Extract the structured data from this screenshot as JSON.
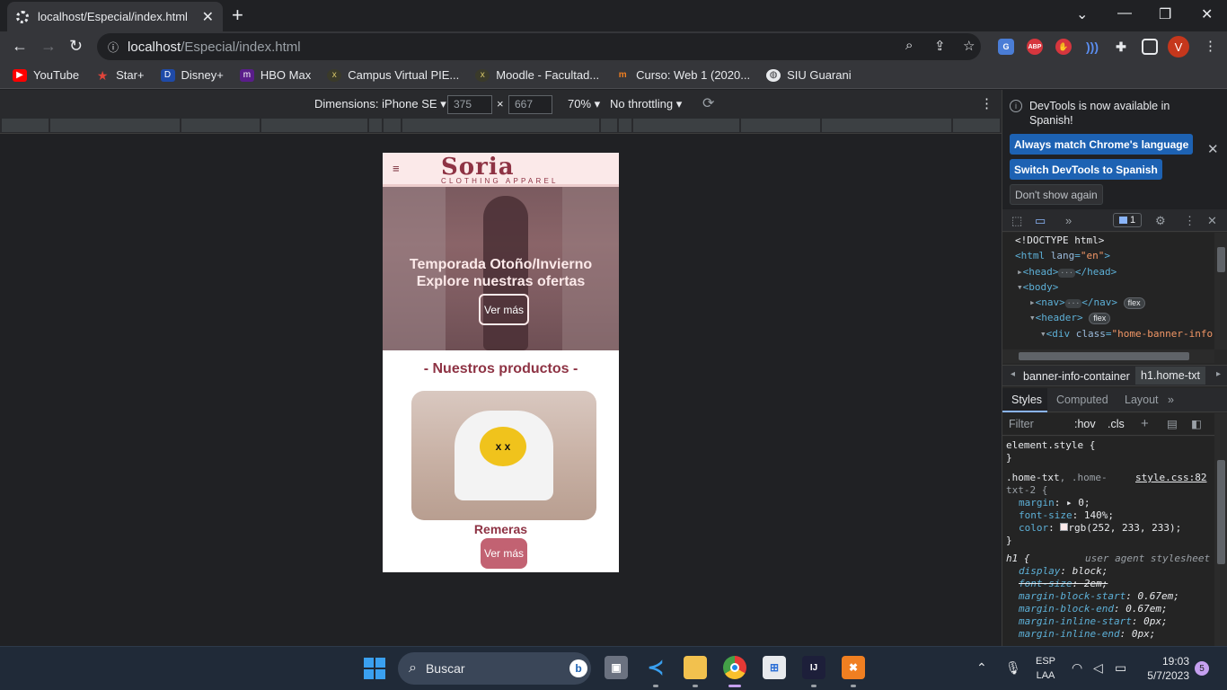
{
  "tab": {
    "title": "localhost/Especial/index.html",
    "close": "✕",
    "new_tab": "+"
  },
  "window": {
    "minimize": "—",
    "maximize": "❐",
    "close": "✕",
    "tab_search": "⌄"
  },
  "address": {
    "host": "localhost",
    "path": "/Especial/index.html"
  },
  "profile": {
    "initial": "V",
    "color": "#c5371c"
  },
  "extensions": [
    {
      "name": "translate-icon",
      "label": "G",
      "color": "#4a7dd6"
    },
    {
      "name": "adblock-icon",
      "label": "ABP",
      "color": "#d6363e"
    },
    {
      "name": "stop-hand-icon",
      "label": "✋",
      "color": "#d6363e"
    },
    {
      "name": "waves-icon",
      "label": ")",
      "color": "#3b6fd6"
    }
  ],
  "bookmarks": [
    {
      "label": "YouTube",
      "icon": "youtube-icon",
      "glyph": "▶",
      "color": "#ff0000"
    },
    {
      "label": "Star+",
      "icon": "star-icon",
      "glyph": "★",
      "color": "#c0392b"
    },
    {
      "label": "Disney+",
      "icon": "disney-icon",
      "glyph": "D",
      "color": "#1f4aa8"
    },
    {
      "label": "HBO Max",
      "icon": "hbo-icon",
      "glyph": "m",
      "color": "#5a1d8a"
    },
    {
      "label": "Campus Virtual PIE...",
      "icon": "campus-icon",
      "glyph": "x",
      "color": "#4a4a2a"
    },
    {
      "label": "Moodle - Facultad...",
      "icon": "moodle-icon",
      "glyph": "x",
      "color": "#4a4a2a"
    },
    {
      "label": "Curso: Web 1 (2020...",
      "icon": "moodle-m-icon",
      "glyph": "m",
      "color": "#f07f21"
    },
    {
      "label": "SIU Guarani",
      "icon": "globe-icon",
      "glyph": "◍",
      "color": "#5f6368"
    }
  ],
  "device_toolbar": {
    "dimensions_label": "Dimensions: iPhone SE",
    "width": "375",
    "height": "667",
    "times": "×",
    "zoom": "70%",
    "throttling": "No throttling"
  },
  "phone": {
    "brand": "Soria",
    "tagline": "CLOTHING APPAREL",
    "menu": "≡",
    "banner_line1": "Temporada Otoño/Invierno",
    "banner_line2": "Explore nuestras ofertas",
    "banner_button": "Ver más",
    "products_title": "- Nuestros productos -",
    "product_face": "x x",
    "product_name": "Remeras",
    "product_button": "Ver más"
  },
  "devtools": {
    "banner_text": "DevTools is now available in Spanish!",
    "btn_match": "Always match Chrome's language",
    "btn_switch": "Switch DevTools to Spanish",
    "btn_dont_show": "Don't show again",
    "issues_count": "1",
    "dom": {
      "doctype": "<!DOCTYPE html>",
      "html_open": "<html",
      "lang_attr": "lang",
      "lang_val": "\"en\"",
      "head": "<head>",
      "head_close": "</head>",
      "body": "<body>",
      "nav": "<nav>",
      "nav_close": "</nav>",
      "header": "<header>",
      "flex": "flex",
      "div_open": "<div",
      "class_attr": "class",
      "class_val": "\"home-banner-info-container\">",
      "ellipsis": "···"
    },
    "breadcrumb1": "banner-info-container",
    "breadcrumb2": "h1.home-txt",
    "styles_tabs": [
      "Styles",
      "Computed",
      "Layout"
    ],
    "filter_placeholder": "Filter",
    "hov": ":hov",
    "cls": ".cls",
    "rules": {
      "element_style": "element.style {",
      "close": "}",
      "home_sel": ".home-txt",
      "home_sel2": ", .home-txt-2 {",
      "home_src": "style.css:82",
      "margin_prop": "margin",
      "margin_val": "0;",
      "fontsize_prop": "font-size",
      "fontsize_val": "140%;",
      "color_prop": "color",
      "color_val": "rgb(252, 233, 233);",
      "h1_sel": "h1 {",
      "h1_src": "user agent stylesheet",
      "display_prop": "display",
      "display_val": "block;",
      "fs_prop": "font-size",
      "fs_val": "2em;",
      "mbs_prop": "margin-block-start",
      "mbs_val": "0.67em;",
      "mbe_prop": "margin-block-end",
      "mbe_val": "0.67em;",
      "mis_prop": "margin-inline-start",
      "mis_val": "0px;",
      "mie_prop": "margin-inline-end",
      "mie_val": "0px;"
    }
  },
  "taskbar": {
    "search": "Buscar",
    "lang1": "ESP",
    "lang2": "LAA",
    "time": "19:03",
    "date": "5/7/2023",
    "notifications": "5"
  }
}
